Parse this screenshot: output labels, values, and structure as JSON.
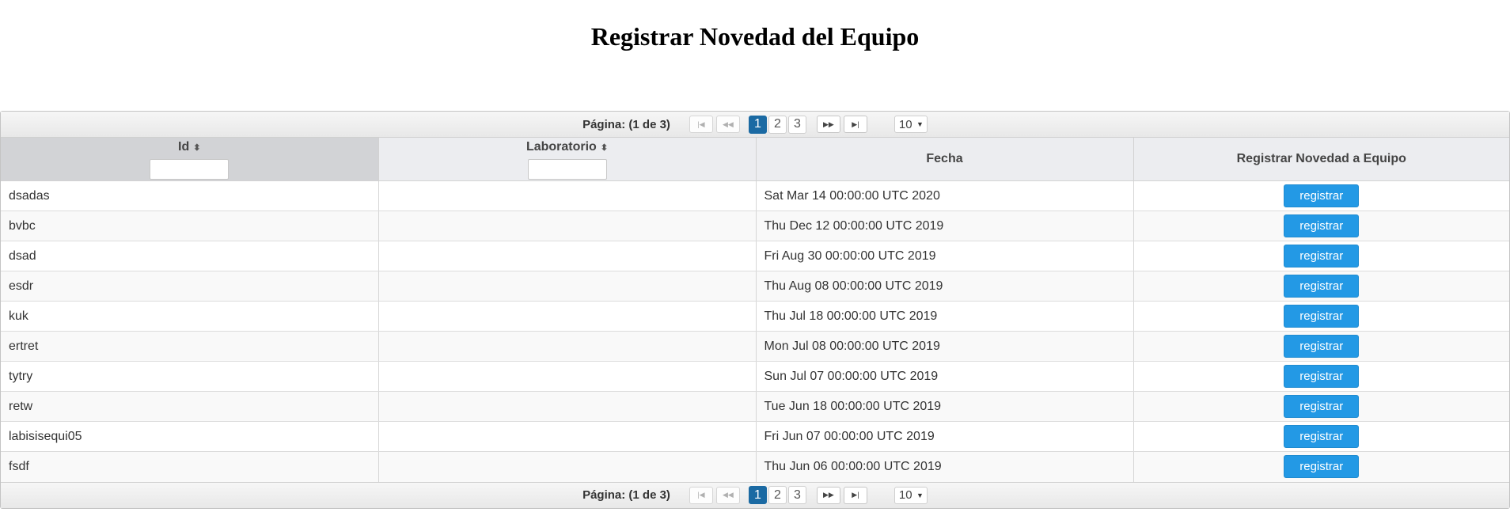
{
  "page": {
    "title": "Registrar Novedad del Equipo"
  },
  "paginator": {
    "current_report": "Página: (1 de 3)",
    "first_icon": "first-page-icon",
    "prev_icon": "previous-page-icon",
    "next_icon": "next-page-icon",
    "last_icon": "last-page-icon",
    "pages": [
      "1",
      "2",
      "3"
    ],
    "active_page": "1",
    "rows_per_page": "10"
  },
  "table": {
    "columns": [
      {
        "label": "Id",
        "sortable": true,
        "filter": true
      },
      {
        "label": "Laboratorio",
        "sortable": true,
        "filter": true
      },
      {
        "label": "Fecha",
        "sortable": false,
        "filter": false
      },
      {
        "label": "Registrar Novedad a Equipo",
        "sortable": false,
        "filter": false
      }
    ],
    "sort_icon": "sort-icon",
    "button_label": "registrar",
    "rows": [
      {
        "id": "dsadas",
        "laboratorio": "",
        "fecha": "Sat Mar 14 00:00:00 UTC 2020"
      },
      {
        "id": "bvbc",
        "laboratorio": "",
        "fecha": "Thu Dec 12 00:00:00 UTC 2019"
      },
      {
        "id": "dsad",
        "laboratorio": "",
        "fecha": "Fri Aug 30 00:00:00 UTC 2019"
      },
      {
        "id": "esdr",
        "laboratorio": "",
        "fecha": "Thu Aug 08 00:00:00 UTC 2019"
      },
      {
        "id": "kuk",
        "laboratorio": "",
        "fecha": "Thu Jul 18 00:00:00 UTC 2019"
      },
      {
        "id": "ertret",
        "laboratorio": "",
        "fecha": "Mon Jul 08 00:00:00 UTC 2019"
      },
      {
        "id": "tytry",
        "laboratorio": "",
        "fecha": "Sun Jul 07 00:00:00 UTC 2019"
      },
      {
        "id": "retw",
        "laboratorio": "",
        "fecha": "Tue Jun 18 00:00:00 UTC 2019"
      },
      {
        "id": "labisisequi05",
        "laboratorio": "",
        "fecha": "Fri Jun 07 00:00:00 UTC 2019"
      },
      {
        "id": "fsdf",
        "laboratorio": "",
        "fecha": "Thu Jun 06 00:00:00 UTC 2019"
      }
    ]
  },
  "colors": {
    "primary_button": "#2399e5",
    "active_page": "#1b6aa3",
    "header_bg": "#ecedf0"
  }
}
